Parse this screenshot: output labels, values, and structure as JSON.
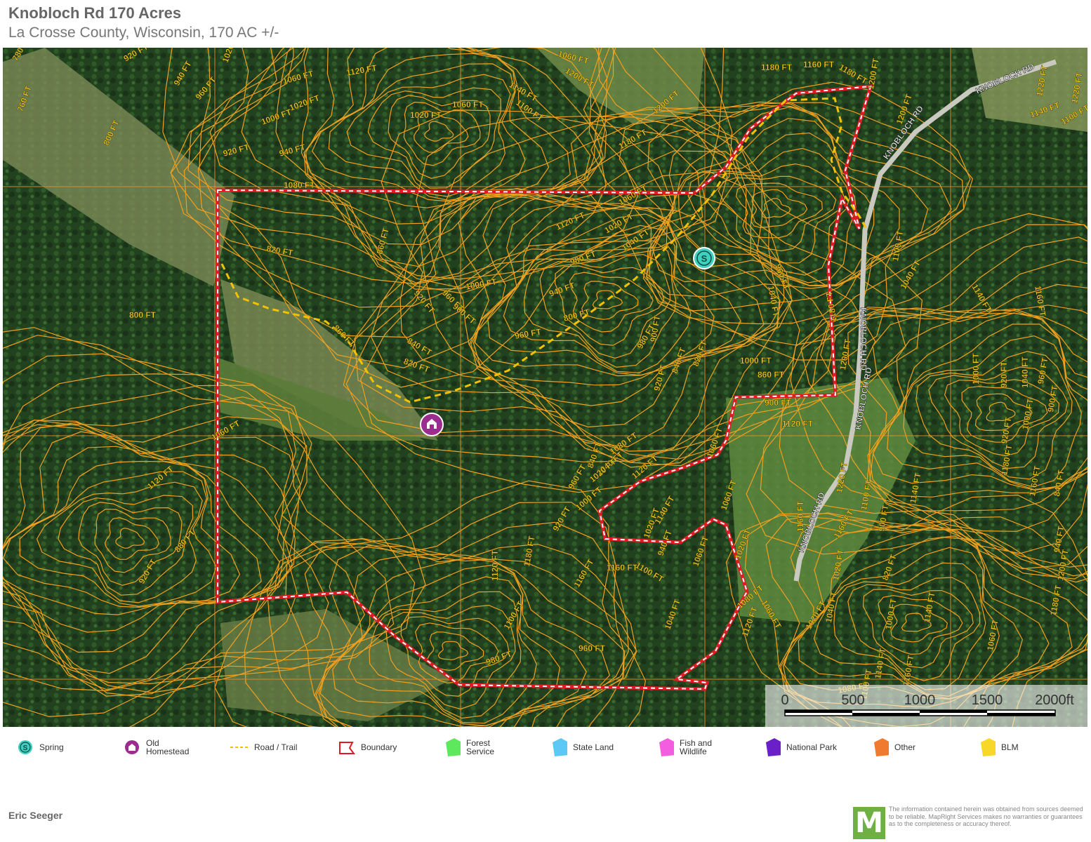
{
  "header": {
    "title": "Knobloch Rd 170 Acres",
    "subtitle": "La Crosse County, Wisconsin, 170 AC +/-"
  },
  "map": {
    "road_labels": [
      "KNOBLOCH RD",
      "KNOBLOCH RD",
      "KNOBLOCH RD",
      "KNOBLOCH RD",
      "KNOBLOCH RD"
    ],
    "contour_labels": [
      "780 FT",
      "760 FT",
      "920 FT",
      "940 FT",
      "960 FT",
      "1020 FT",
      "1060 FT",
      "1120 FT",
      "1060 FT",
      "1200 FT",
      "1180 FT",
      "1160 FT",
      "1180 FT",
      "1200 FT",
      "1140 FT",
      "1100 FT",
      "1020 FT",
      "1060 FT",
      "1000 FT",
      "1020 FT",
      "800 FT",
      "920 FT",
      "940 FT",
      "1180 FT",
      "1200 FT",
      "1140 FT",
      "1100 FT",
      "820 FT",
      "860 FT",
      "1120 FT",
      "1060 FT",
      "1020 FT",
      "1040 FT",
      "980 FT",
      "1000 FT",
      "940 FT",
      "960 FT",
      "920 FT",
      "960 FT",
      "900 FT",
      "800 FT",
      "860 FT",
      "840 FT",
      "820 FT",
      "800 FT",
      "840 FT",
      "980 FT",
      "920 FT",
      "900 FT",
      "840 FT",
      "820 FT",
      "1060 FT",
      "1000 FT",
      "1040 FT",
      "960 FT",
      "860 FT",
      "900 FT",
      "1120 FT",
      "1160 FT",
      "1180 FT",
      "1200 FT",
      "1220 FT",
      "1160 FT",
      "1100 FT",
      "1040 FT",
      "1140 FT",
      "1160 FT",
      "1000 FT",
      "920 FT",
      "1040 FT",
      "960 FT",
      "900 FT",
      "840 FT",
      "940 FT",
      "920 FT",
      "1000 FT",
      "1020 FT",
      "940 FT",
      "920 FT",
      "960 FT",
      "1000 FT",
      "1040 FT",
      "1020 FT",
      "1080 FT",
      "1120 FT",
      "1160 FT",
      "1140 FT",
      "1100 FT",
      "1020 FT",
      "1060 FT",
      "1040 FT",
      "1020 FT",
      "1080 FT",
      "1100 FT",
      "1140 FT",
      "1160 FT",
      "1140 FT",
      "1060 FT",
      "1180 FT",
      "1200 FT",
      "1220 FT",
      "1220 FT",
      "1200 FT",
      "1180 FT",
      "1160 FT",
      "1140 FT",
      "1100 FT",
      "1020 FT",
      "900 FT",
      "820 FT",
      "1000 FT",
      "1080 FT",
      "1060 FT",
      "1120 FT",
      "880 FT",
      "920 FT",
      "960 FT",
      "980 FT",
      "1040 FT",
      "1060 FT",
      "1100 FT",
      "1120 FT",
      "1180 FT",
      "1160 FT",
      "1060 FT",
      "1080 FT",
      "1120 FT"
    ],
    "markers": {
      "spring": "S",
      "homestead": "barn-icon"
    },
    "scale_bar": {
      "ticks": [
        "0",
        "500",
        "1000",
        "1500",
        "2000ft"
      ]
    },
    "colors": {
      "boundary": "#e01b24",
      "trail": "#f2c200",
      "contour": "#f0a020",
      "parcel": "#f08a24",
      "spring": "#3fd0c0",
      "homestead": "#9b2d8f"
    }
  },
  "legend": [
    {
      "label": "Spring",
      "icon": "spring-icon",
      "color": "#3fd0c0"
    },
    {
      "label": "Old\nHomestead",
      "icon": "homestead-icon",
      "color": "#9b2d8f"
    },
    {
      "label": "Road / Trail",
      "icon": "trail-icon",
      "color": "#f2c200"
    },
    {
      "label": "Boundary",
      "icon": "boundary-icon",
      "color": "#e01b24"
    },
    {
      "label": "Forest\nService",
      "icon": "forest-service-icon",
      "color": "#5ee85e"
    },
    {
      "label": "State Land",
      "icon": "state-land-icon",
      "color": "#5bc8f5"
    },
    {
      "label": "Fish and\nWildlife",
      "icon": "fish-wildlife-icon",
      "color": "#f55de0"
    },
    {
      "label": "National Park",
      "icon": "national-park-icon",
      "color": "#6a1fc8"
    },
    {
      "label": "Other",
      "icon": "other-icon",
      "color": "#f07a30"
    },
    {
      "label": "BLM",
      "icon": "blm-icon",
      "color": "#f7d72a"
    }
  ],
  "footer": {
    "author": "Eric Seeger",
    "logo_letter": "M",
    "disclaimer": "The information contained herein was obtained from sources deemed to be reliable. MapRight Services makes no warranties or guarantees as to the completeness or accuracy thereof."
  }
}
